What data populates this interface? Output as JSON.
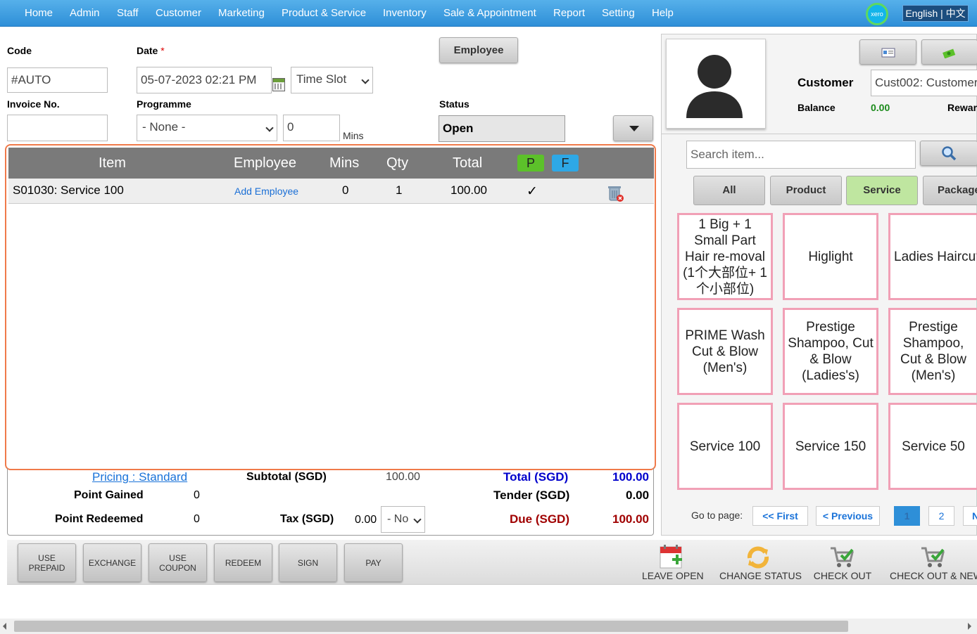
{
  "nav": {
    "items": [
      "Home",
      "Admin",
      "Staff",
      "Customer",
      "Marketing",
      "Product & Service",
      "Inventory",
      "Sale & Appointment",
      "Report",
      "Setting",
      "Help"
    ],
    "xero": "xero",
    "language": "English | 中文"
  },
  "form": {
    "code_label": "Code",
    "code_value": "#AUTO",
    "date_label": "Date",
    "date_required": "*",
    "date_value": "05-07-2023 02:21 PM",
    "timeslot_value": "Time Slot",
    "employee_button": "Employee",
    "invoice_label": "Invoice No.",
    "invoice_value": "",
    "programme_label": "Programme",
    "programme_value": "- None -",
    "mins_value": "0",
    "mins_label": "Mins",
    "status_label": "Status",
    "status_value": "Open"
  },
  "grid": {
    "headers": {
      "item": "Item",
      "employee": "Employee",
      "mins": "Mins",
      "qty": "Qty",
      "total": "Total",
      "p": "P",
      "f": "F"
    },
    "rows": [
      {
        "item": "S01030: Service 100",
        "employee": "Add Employee",
        "mins": "0",
        "qty": "1",
        "total": "100.00",
        "check": "✓"
      }
    ]
  },
  "totals": {
    "pricing": "Pricing : Standard",
    "subtotal_label": "Subtotal (SGD)",
    "subtotal_value": "100.00",
    "total_label": "Total (SGD)",
    "total_value": "100.00",
    "point_gained_label": "Point Gained",
    "point_gained_value": "0",
    "tender_label": "Tender (SGD)",
    "tender_value": "0.00",
    "point_redeemed_label": "Point Redeemed",
    "point_redeemed_value": "0",
    "tax_label": "Tax (SGD)",
    "tax_value": "0.00",
    "tax_select": "- No",
    "due_label": "Due (SGD)",
    "due_value": "100.00"
  },
  "actions": {
    "buttons": [
      "USE PREPAID",
      "EXCHANGE",
      "USE COUPON",
      "REDEEM",
      "SIGN",
      "PAY"
    ],
    "icons": [
      {
        "label": "LEAVE OPEN",
        "icon": "calendar-add-icon"
      },
      {
        "label": "CHANGE STATUS",
        "icon": "refresh-icon"
      },
      {
        "label": "CHECK OUT",
        "icon": "cart-check-icon"
      },
      {
        "label": "CHECK OUT & NEW",
        "icon": "cart-check-new-icon"
      }
    ]
  },
  "customer": {
    "label": "Customer",
    "value": "Cust002: Customer",
    "balance_label": "Balance",
    "balance_value": "0.00",
    "reward_label": "Reward"
  },
  "search": {
    "placeholder": "Search item..."
  },
  "categories": [
    "All",
    "Product",
    "Service",
    "Package"
  ],
  "active_category": "Service",
  "tiles": [
    "1 Big + 1 Small Part Hair re-moval (1个大部位+ 1个小部位)",
    "Higlight",
    "Ladies Haircut",
    "PRIME Wash Cut & Blow (Men's)",
    "Prestige Shampoo, Cut & Blow (Ladies's)",
    "Prestige Shampoo, Cut & Blow (Men's)",
    "Service 100",
    "Service 150",
    "Service 50"
  ],
  "pagination": {
    "label": "Go to page:",
    "first": "<< First",
    "previous": "< Previous",
    "pages": [
      "1",
      "2"
    ],
    "next": "N"
  },
  "colors": {
    "nav": "#2e8fd8",
    "grid_border": "#f07a4a",
    "tile_border": "#f1a0b6",
    "active_category": "#bfe6a0",
    "total_blue": "#0000cc",
    "due_red": "#a00000",
    "p_badge": "#5cc12a",
    "f_badge": "#2ea8e6"
  }
}
